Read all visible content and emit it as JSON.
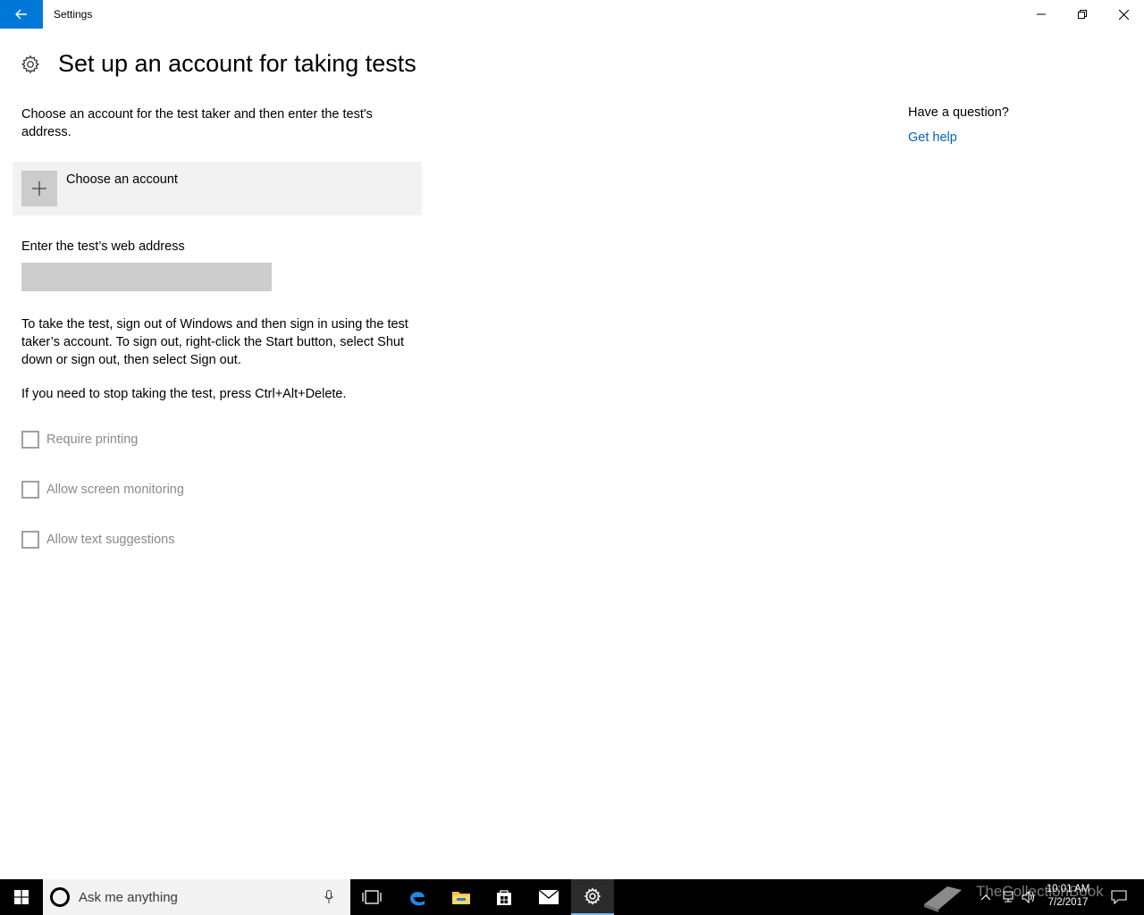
{
  "window": {
    "title": "Settings"
  },
  "page": {
    "title": "Set up an account for taking tests",
    "intro": "Choose an account for the test taker and then enter the test's address.",
    "choose_account_label": "Choose an account",
    "web_address_label": "Enter the test’s web address",
    "web_address_value": "",
    "instructions": "To take the test, sign out of Windows and then sign in using the test taker’s account. To sign out, right-click the Start button, select Shut down or sign out, then select Sign out.",
    "stop_text": "If you need to stop taking the test, press Ctrl+Alt+Delete.",
    "checkboxes": [
      {
        "label": "Require printing",
        "checked": false,
        "enabled": false
      },
      {
        "label": "Allow screen monitoring",
        "checked": false,
        "enabled": false
      },
      {
        "label": "Allow text suggestions",
        "checked": false,
        "enabled": false
      }
    ]
  },
  "help": {
    "title": "Have a question?",
    "link": "Get help"
  },
  "taskbar": {
    "search_placeholder": "Ask me anything",
    "watermark": "TheCollectionBook",
    "time": "10:01 AM",
    "date": "7/2/2017"
  },
  "colors": {
    "accent": "#0078d7",
    "link": "#0067b8",
    "disabled_text": "#8a8a8a",
    "input_bg": "#cccccc",
    "tile_bg": "#f2f2f2"
  }
}
